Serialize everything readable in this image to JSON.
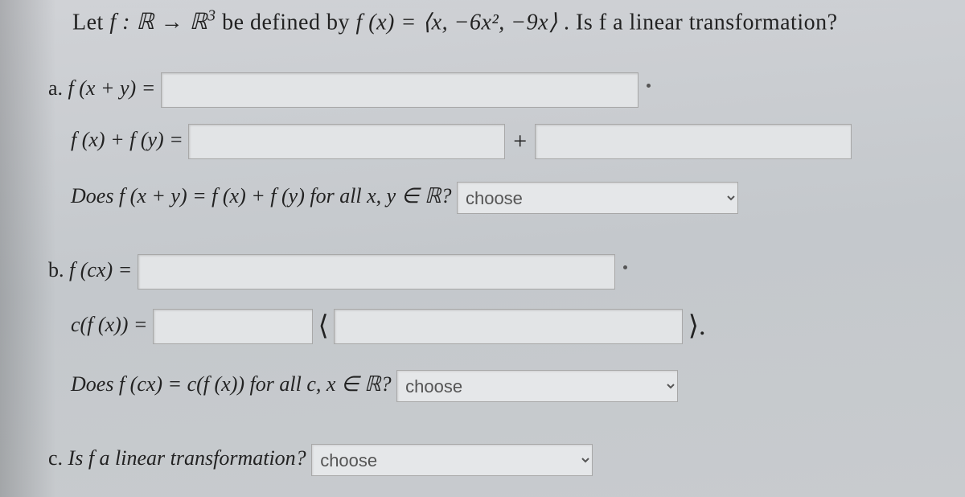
{
  "question": {
    "prefix": "Let ",
    "func": "f : ℝ → ℝ",
    "exp": "3",
    "mid": " be defined by ",
    "def": "f (x) = ⟨x, −6x²,  −9x⟩",
    "tail": ". Is f a linear transformation?"
  },
  "a": {
    "letter": "a.",
    "line1_lhs": "f (x + y) =",
    "line2_lhs": "f (x) + f (y) =",
    "plus": "+",
    "q": "Does f (x + y) = f (x) + f (y) for all x, y ∈ ℝ?"
  },
  "b": {
    "letter": "b.",
    "line1_lhs": "f (cx) =",
    "line2_lhs": "c(f (x)) =",
    "lparen": "⟨",
    "rparen": "⟩.",
    "q": "Does f (cx) = c(f (x)) for all c, x ∈ ℝ?"
  },
  "c": {
    "letter": "c.",
    "q": "Is f a linear transformation?"
  },
  "choose": "choose"
}
